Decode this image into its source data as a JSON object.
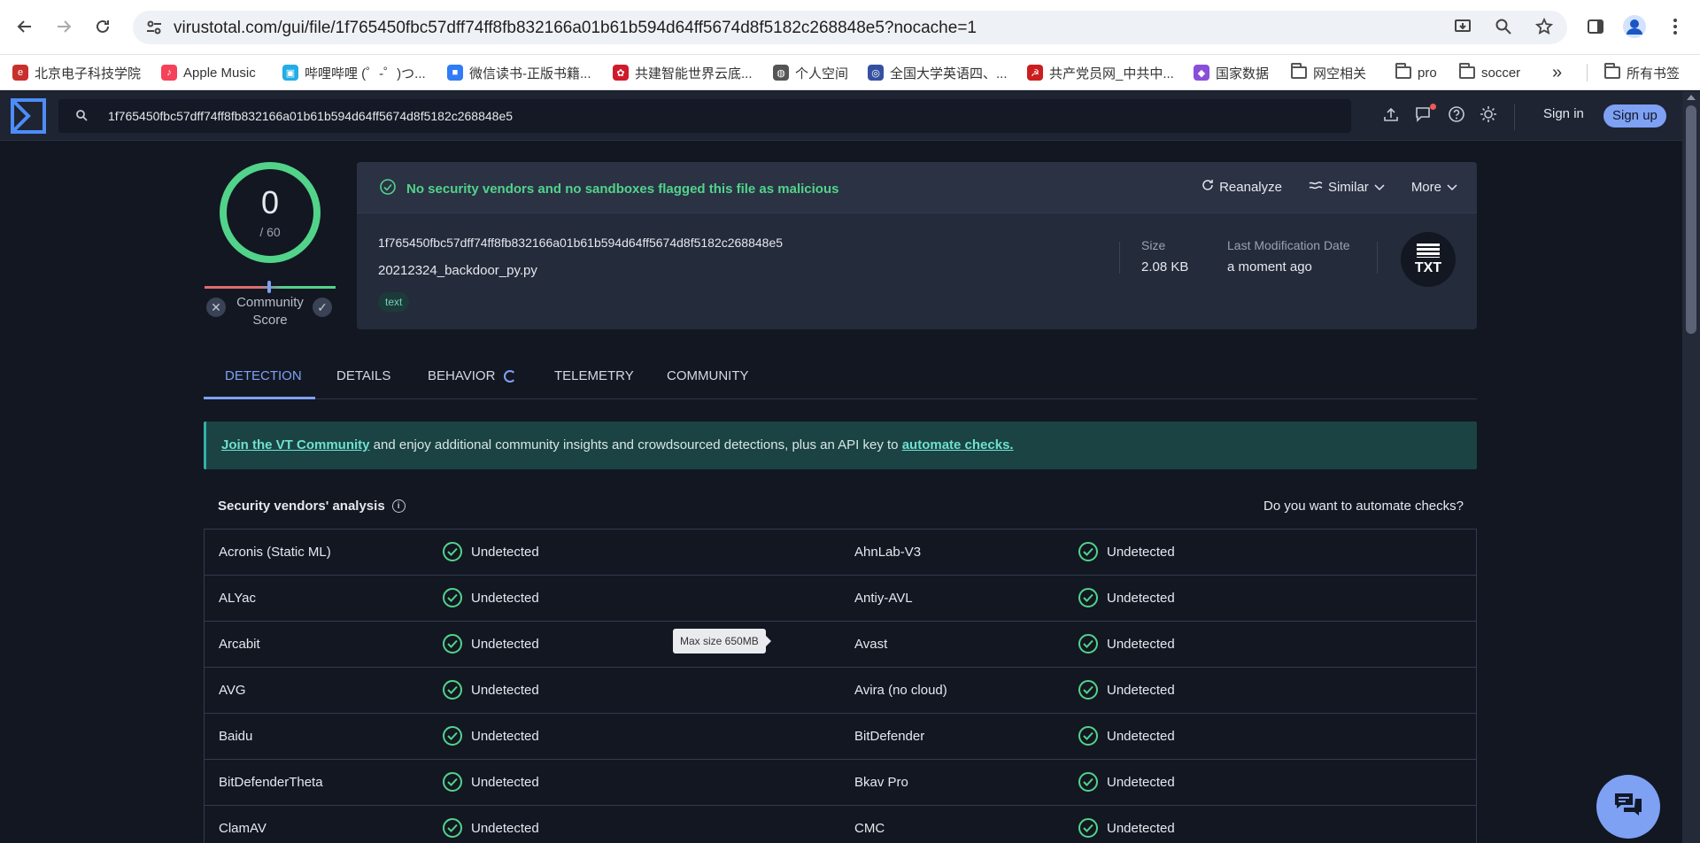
{
  "browser": {
    "url": "virustotal.com/gui/file/1f765450fbc57dff74ff8fb832166a01b61b594d64ff5674d8f5182c268848e5?nocache=1",
    "bookmarks": [
      {
        "label": "北京电子科技学院",
        "color": "#c9302c"
      },
      {
        "label": "Apple Music",
        "color": "#f5425a"
      },
      {
        "label": "哔哩哔哩 (゜-゜)つ...",
        "color": "#23ade5"
      },
      {
        "label": "微信读书-正版书籍...",
        "color": "#2f7cf6"
      },
      {
        "label": "共建智能世界云底...",
        "color": "#cf1c2c"
      },
      {
        "label": "个人空间",
        "color": "#555555"
      },
      {
        "label": "全国大学英语四、...",
        "color": "#3450a0"
      },
      {
        "label": "共产党员网_中共中...",
        "color": "#cc1e1e"
      },
      {
        "label": "国家数据",
        "color": "#8a4fd8"
      },
      {
        "label": "网空相关",
        "color": ""
      },
      {
        "label": "pro",
        "color": ""
      },
      {
        "label": "soccer",
        "color": ""
      }
    ],
    "more_bookmarks": "»",
    "all_bookmarks": "所有书签"
  },
  "vt": {
    "search_query": "1f765450fbc57dff74ff8fb832166a01b61b594d64ff5674d8f5182c268848e5",
    "sign_in": "Sign in",
    "sign_up": "Sign up"
  },
  "score": {
    "detections": "0",
    "total": "/ 60",
    "community_label": "Community Score"
  },
  "file": {
    "verdict": "No security vendors and no sandboxes flagged this file as malicious",
    "reanalyze": "Reanalyze",
    "similar": "Similar",
    "more": "More",
    "hash": "1f765450fbc57dff74ff8fb832166a01b61b594d64ff5674d8f5182c268848e5",
    "name": "20212324_backdoor_py.py",
    "tag": "text",
    "size_label": "Size",
    "size_value": "2.08 KB",
    "mod_label": "Last Modification Date",
    "mod_value": "a moment ago",
    "type_badge": "TXT"
  },
  "tabs": [
    "DETECTION",
    "DETAILS",
    "BEHAVIOR",
    "TELEMETRY",
    "COMMUNITY"
  ],
  "banner": {
    "link1": "Join the VT Community",
    "middle": " and enjoy additional community insights and crowdsourced detections, plus an API key to ",
    "link2": "automate checks."
  },
  "vendors": {
    "title": "Security vendors' analysis",
    "automate_question": "Do you want to automate checks?",
    "rows": [
      {
        "left": "Acronis (Static ML)",
        "left_result": "Undetected",
        "right": "AhnLab-V3",
        "right_result": "Undetected"
      },
      {
        "left": "ALYac",
        "left_result": "Undetected",
        "right": "Antiy-AVL",
        "right_result": "Undetected"
      },
      {
        "left": "Arcabit",
        "left_result": "Undetected",
        "right": "Avast",
        "right_result": "Undetected"
      },
      {
        "left": "AVG",
        "left_result": "Undetected",
        "right": "Avira (no cloud)",
        "right_result": "Undetected"
      },
      {
        "left": "Baidu",
        "left_result": "Undetected",
        "right": "BitDefender",
        "right_result": "Undetected"
      },
      {
        "left": "BitDefenderTheta",
        "left_result": "Undetected",
        "right": "Bkav Pro",
        "right_result": "Undetected"
      },
      {
        "left": "ClamAV",
        "left_result": "Undetected",
        "right": "CMC",
        "right_result": "Undetected"
      }
    ]
  },
  "tooltip": "Max size 650MB",
  "colors": {
    "accent": "#7ea1f4",
    "clean": "#52d38a",
    "background": "#131722"
  }
}
